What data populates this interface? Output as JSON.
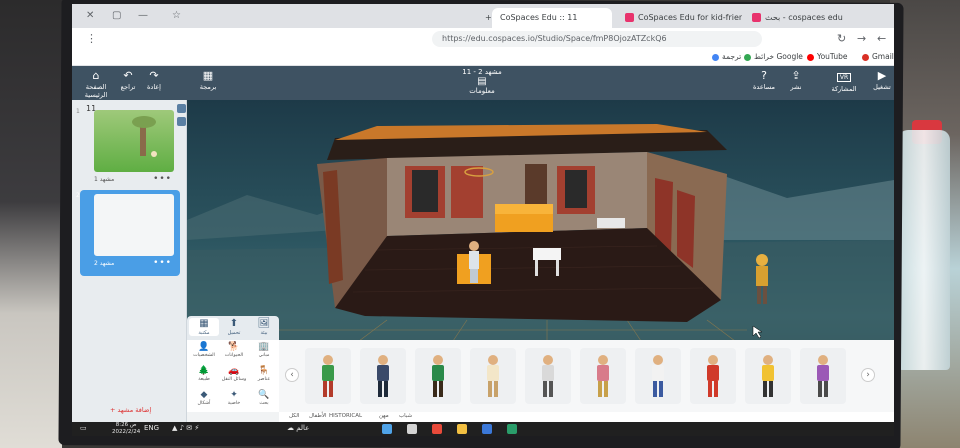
{
  "browser": {
    "tabs": [
      {
        "label": "بحث - cospaces edu",
        "active": false
      },
      {
        "label": "CoSpaces Edu for kid-friendly 3D",
        "active": false
      },
      {
        "label": "CoSpaces Edu :: 11",
        "active": true
      }
    ],
    "new_tab": "+",
    "url": "https://edu.cospaces.io/Studio/Space/fmP8OjozATZckQ6",
    "bookmarks": [
      {
        "label": "Gmail",
        "color": "#d93025"
      },
      {
        "label": "YouTube",
        "color": "#ff0000"
      },
      {
        "label": "خرائط Google",
        "color": "#34a853"
      },
      {
        "label": "ترجمة",
        "color": "#4285f4"
      }
    ],
    "icons": {
      "back": "←",
      "forward": "→",
      "reload": "↻",
      "star": "☆",
      "share": "⤴",
      "menu": "⋮",
      "close": "✕",
      "min": "—",
      "max": "▢"
    }
  },
  "app": {
    "toolbar": {
      "home": "الصفحة الرئيسية",
      "undo": "تراجع",
      "redo": "إعادة",
      "code": "برمجة",
      "scene_name": "مشهد 2 - 11",
      "scene_info": "معلومات",
      "help": "مساعدة",
      "share": "نشر",
      "vr": "المشاركة",
      "play": "تشغيل",
      "vr_badge": "VR"
    },
    "scenes_panel": {
      "count": "11",
      "scenes": [
        {
          "index": "1",
          "label": "مشهد 1",
          "more": "•••",
          "thumb_color": "#5fae43"
        },
        {
          "index": "2",
          "label": "مشهد 2",
          "more": "•••",
          "thumb_color": "#f4f6f7"
        }
      ],
      "add_scene": "+ إضافة مشهد"
    },
    "library": {
      "tabs": [
        {
          "label": "مكتبة",
          "icon": "▦"
        },
        {
          "label": "تحميل",
          "icon": "⬆"
        },
        {
          "label": "بيئة",
          "icon": "🖼"
        }
      ],
      "categories": [
        {
          "label": "الشخصيات",
          "icon": "👤",
          "active": true
        },
        {
          "label": "الحيوانات",
          "icon": "🐕"
        },
        {
          "label": "مباني",
          "icon": "🏢"
        },
        {
          "label": "طبيعة",
          "icon": "🌲"
        },
        {
          "label": "وسائل النقل",
          "icon": "🚗"
        },
        {
          "label": "عناصر",
          "icon": "🪑"
        },
        {
          "label": "أشكال",
          "icon": "◆"
        },
        {
          "label": "خاصية",
          "icon": "✦"
        },
        {
          "label": "بحث",
          "icon": "🔍"
        }
      ],
      "subfilters": [
        "الكل",
        "الأطفال",
        "HISTORICAL",
        "مهن",
        "شباب"
      ],
      "prev": "‹",
      "next": "›",
      "characters": [
        {
          "shirt": "#3a9a4a",
          "pants": "#b33b2b"
        },
        {
          "shirt": "#3a4a6a",
          "pants": "#1e2a3a"
        },
        {
          "shirt": "#2a8a4a",
          "pants": "#3a2a1a"
        },
        {
          "shirt": "#f3e6c8",
          "pants": "#c8a26a"
        },
        {
          "shirt": "#d9d9d9",
          "pants": "#555555"
        },
        {
          "shirt": "#d87b8a",
          "pants": "#c7a04a"
        },
        {
          "shirt": "#f2f2f2",
          "pants": "#3b5aa0"
        },
        {
          "shirt": "#d03a2a",
          "pants": "#d03a2a"
        },
        {
          "shirt": "#f1c232",
          "pants": "#333333"
        },
        {
          "shirt": "#9b59b6",
          "pants": "#4a4a4a"
        }
      ]
    }
  },
  "taskbar": {
    "time": "8:26 ص",
    "date": "2022/2/24",
    "lang": "ENG",
    "weather": "عالم"
  }
}
